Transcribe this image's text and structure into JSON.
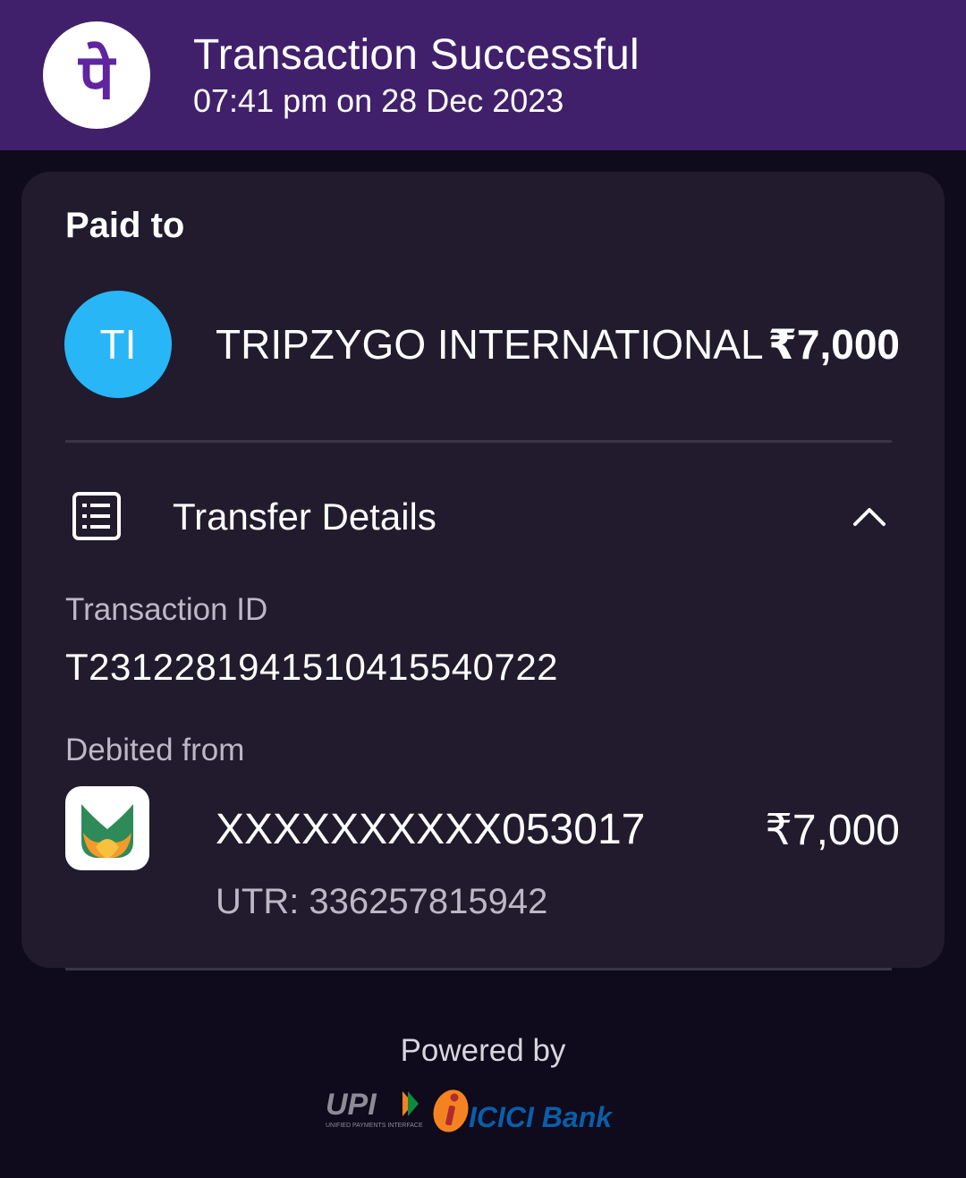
{
  "header": {
    "app_logo_text": "पे",
    "title": "Transaction Successful",
    "subtitle": "07:41 pm on 28 Dec 2023"
  },
  "paid_to": {
    "label": "Paid to",
    "avatar_initials": "TI",
    "payee_name": "TRIPZYGO INTERNATIONAL",
    "amount": "₹7,000"
  },
  "transfer_details": {
    "title": "Transfer Details",
    "icon": "list-document-icon",
    "toggle_icon": "chevron-up-icon",
    "transaction_id_label": "Transaction ID",
    "transaction_id": "T2312281941510415540722",
    "debited_from_label": "Debited from",
    "account_number": "XXXXXXXXXX053017",
    "debit_amount": "₹7,000",
    "utr": "UTR: 336257815942"
  },
  "footer": {
    "powered_by": "Powered by",
    "upi_logo_text": "UPI",
    "upi_logo_subtext": "UNIFIED PAYMENTS INTERFACE",
    "bank_logo_text": "ICICI Bank"
  },
  "colors": {
    "header_bg": "#41206b",
    "brand_purple": "#5f259f",
    "card_bg": "#211b2d",
    "page_bg": "#0f0a1c",
    "avatar_bg": "#29b6f6",
    "icici_orange": "#f58220",
    "icici_red": "#b02a30",
    "icici_blue": "#053c6d"
  }
}
